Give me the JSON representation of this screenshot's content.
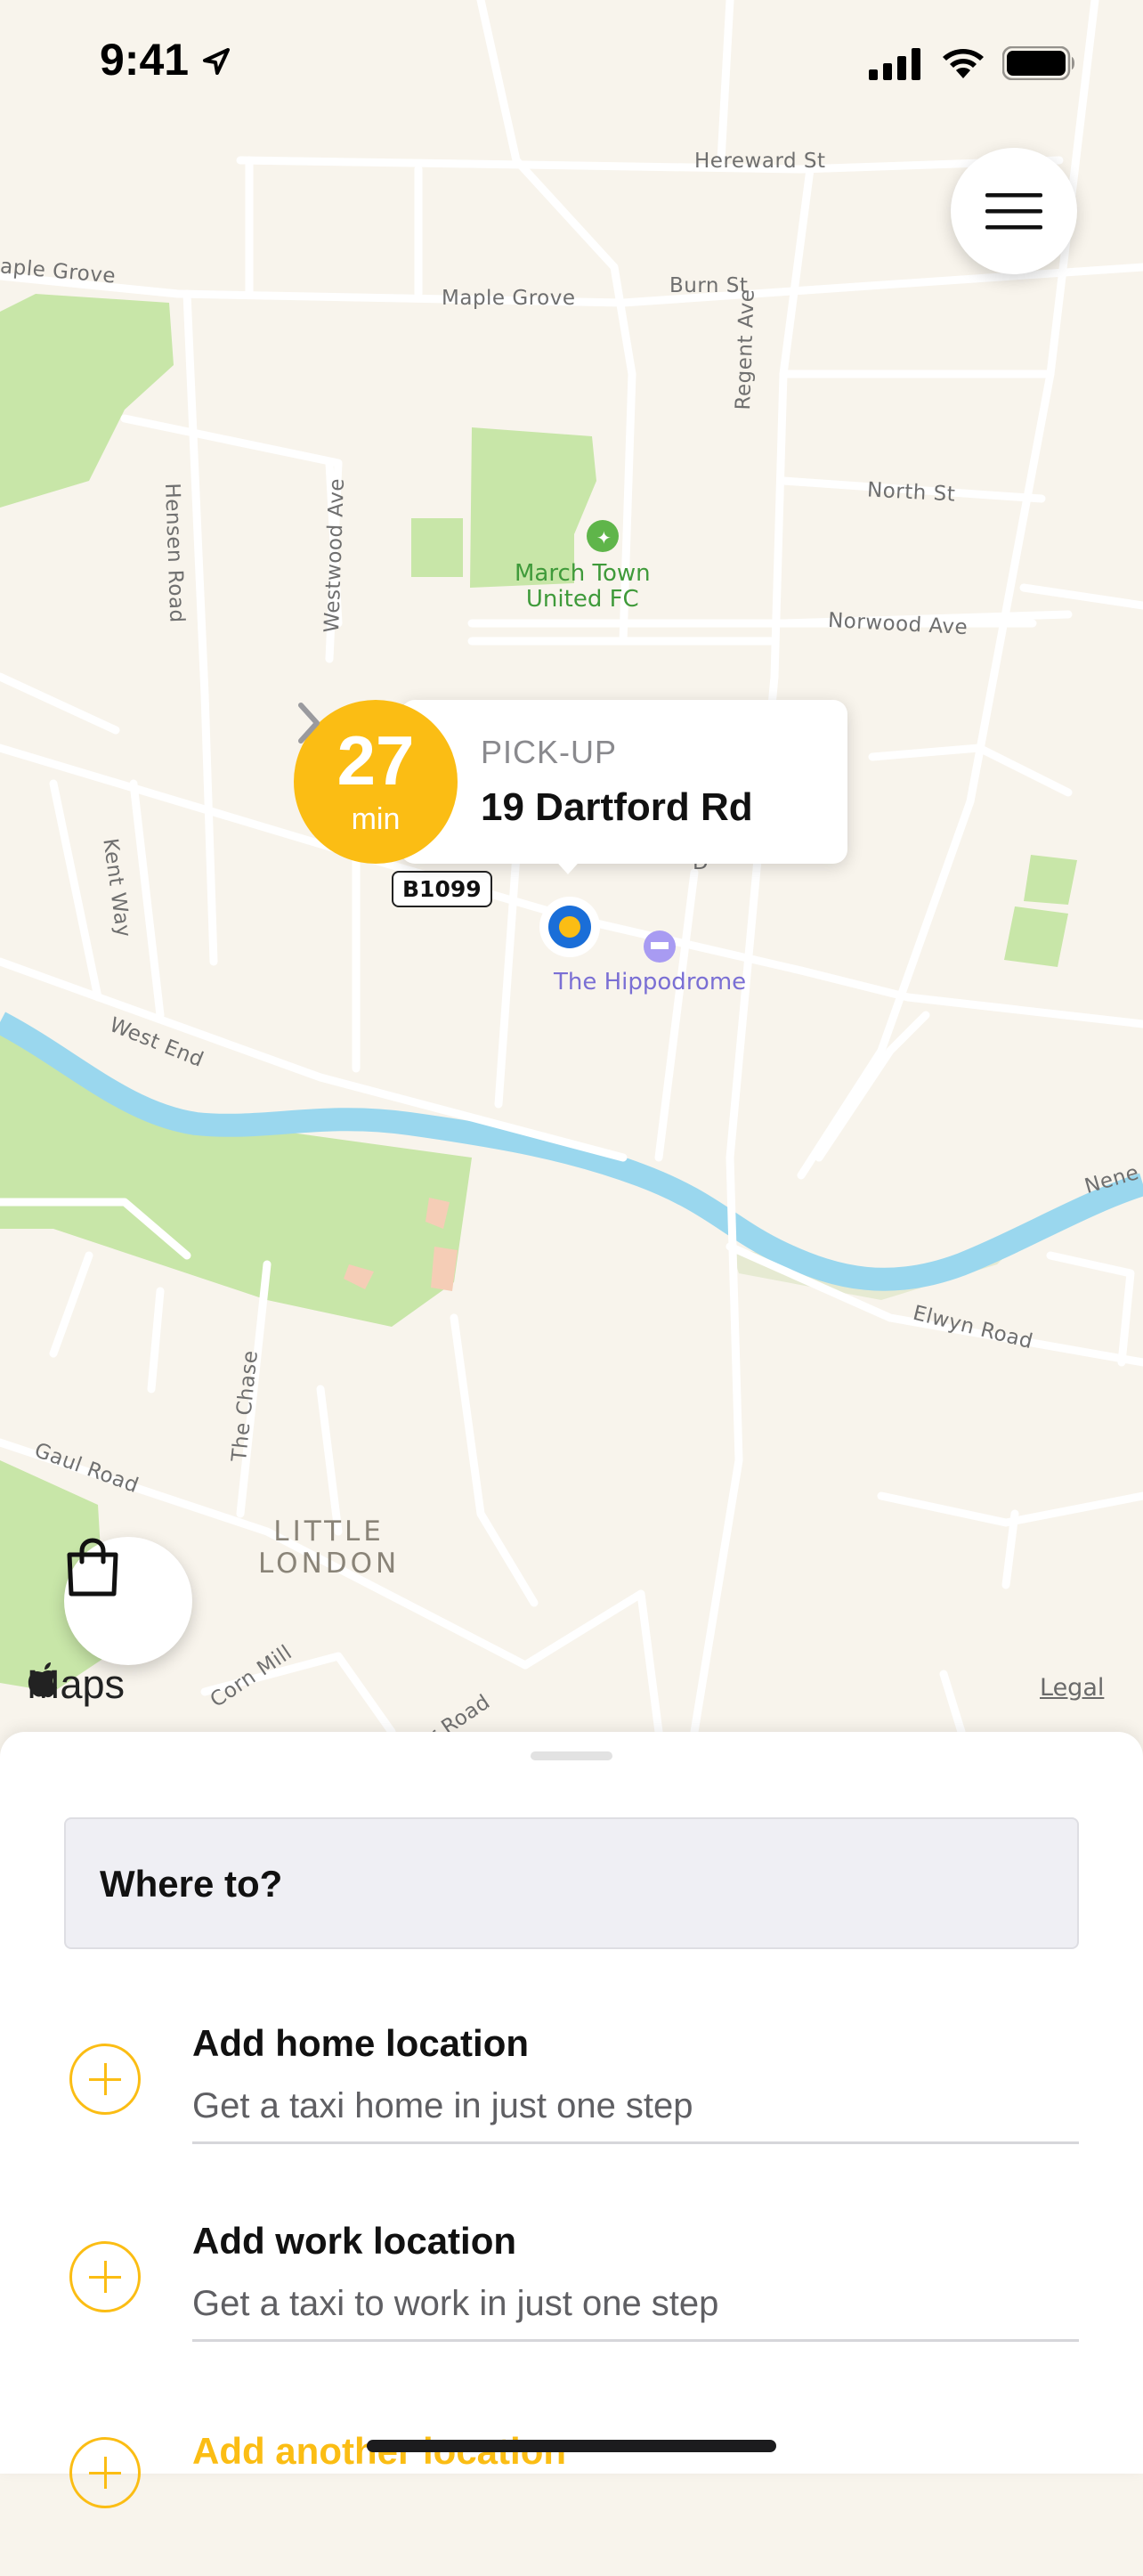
{
  "status_bar": {
    "time": "9:41"
  },
  "map": {
    "streets": [
      "Hereward St",
      "aple Grove",
      "Maple Grove",
      "Burn St",
      "Regent Ave",
      "North St",
      "Hensen Road",
      "Westwood Ave",
      "Norwood Ave",
      "Kent Way",
      "West End",
      "Elwyn Road",
      "Nene",
      "The Chase",
      "Gaul Road",
      "Corn Mill",
      "er Road",
      "D"
    ],
    "poi_name": "March Town\nUnited FC",
    "hotel_name": "The Hippodrome",
    "area_name": "LITTLE\nLONDON",
    "road_badge": "B1099",
    "brand": "Maps",
    "legal": "Legal"
  },
  "pickup": {
    "eta_value": "27",
    "eta_unit": "min",
    "label": "PICK-UP",
    "address": "19 Dartford Rd"
  },
  "sheet": {
    "search_placeholder": "Where to?",
    "locations": [
      {
        "title": "Add home location",
        "subtitle": "Get a taxi home in just one step"
      },
      {
        "title": "Add work location",
        "subtitle": "Get a taxi to work in just one step"
      },
      {
        "title": "Add another location"
      }
    ]
  },
  "colors": {
    "accent": "#fbbd14",
    "map_bg": "#f8f4ec",
    "water": "#9ad7ee",
    "park": "#c8e6a8"
  }
}
